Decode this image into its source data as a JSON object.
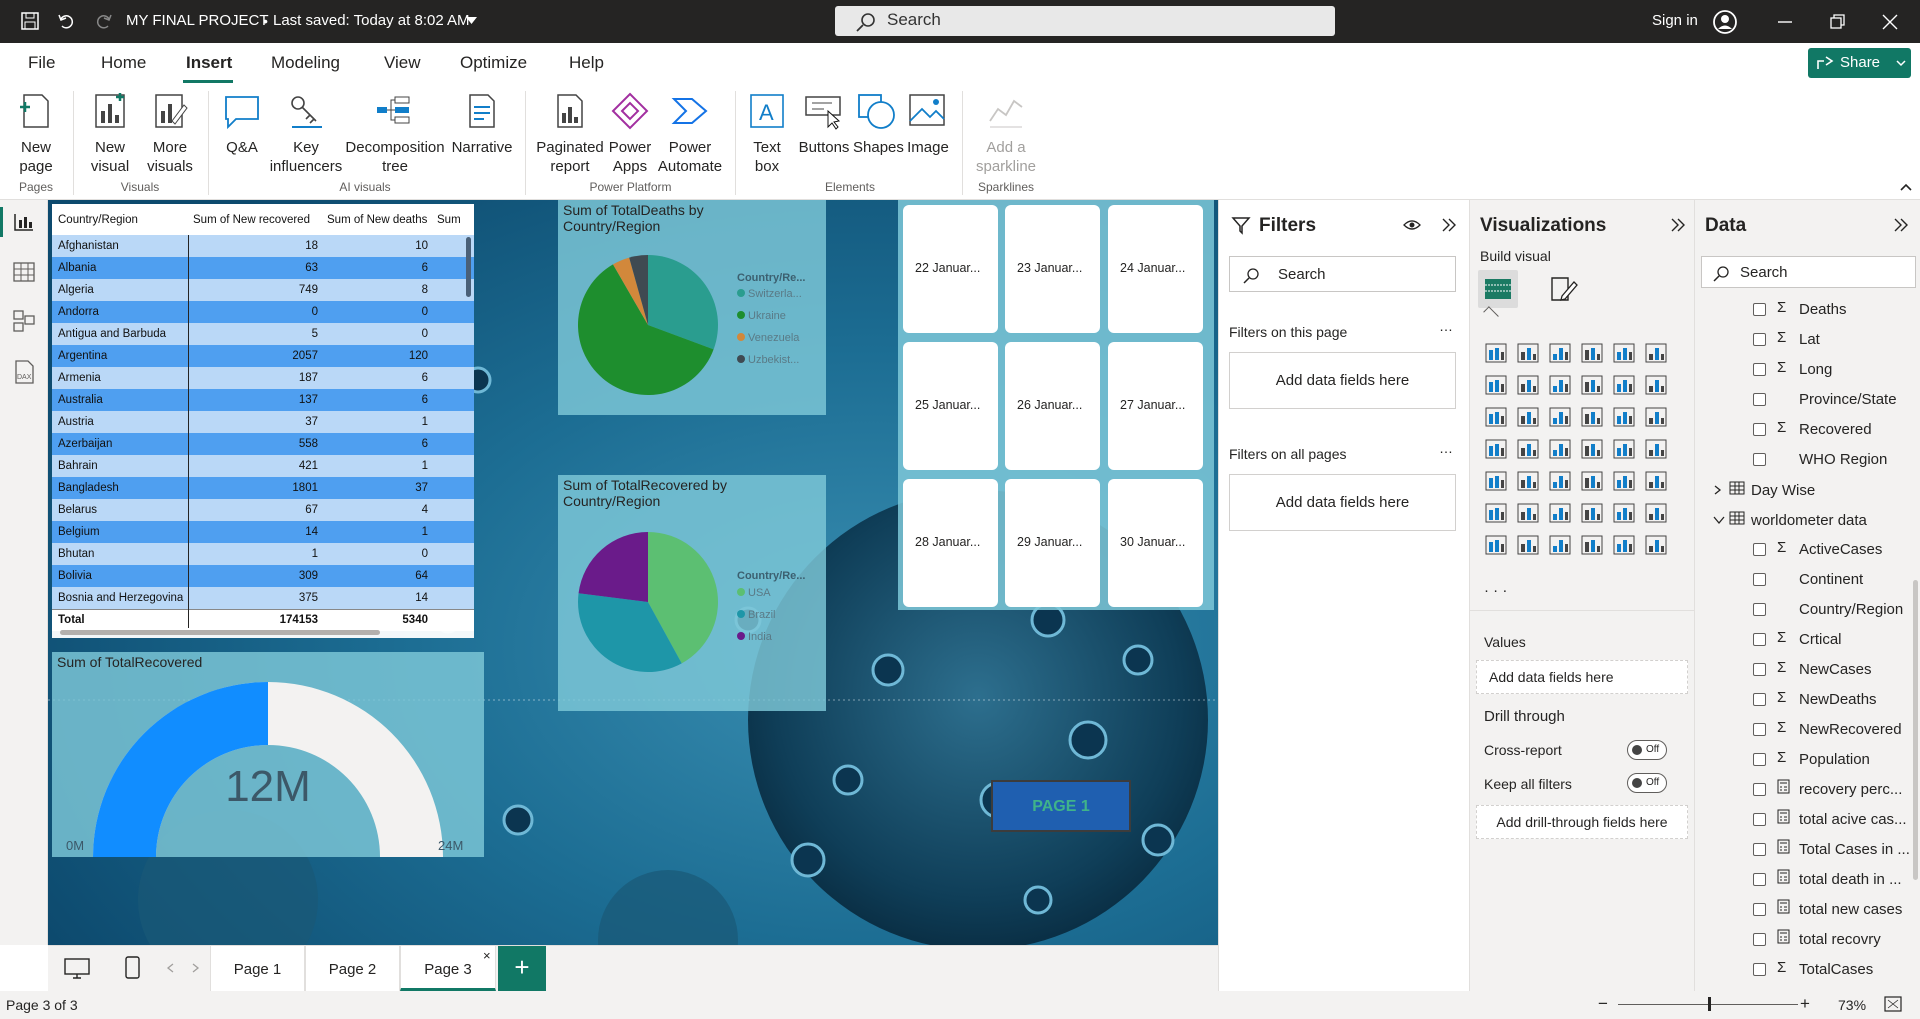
{
  "titlebar": {
    "title": "MY FINAL PROJECT",
    "saved": "Last saved: Today at 8:02 AM",
    "search_placeholder": "Search",
    "sign_in": "Sign in"
  },
  "ribbon_tabs": [
    "File",
    "Home",
    "Insert",
    "Modeling",
    "View",
    "Optimize",
    "Help"
  ],
  "share_label": "Share",
  "ribbon": {
    "new_page": "New page",
    "new_visual": "New visual",
    "more_visuals": "More visuals",
    "qa": "Q&A",
    "key_influencers": "Key influencers",
    "decomposition_tree": "Decomposition tree",
    "narrative": "Narrative",
    "paginated_report": "Paginated report",
    "power_apps": "Power Apps",
    "power_automate": "Power Automate",
    "text_box": "Text box",
    "buttons": "Buttons",
    "shapes": "Shapes",
    "image": "Image",
    "add_sparkline": "Add a sparkline",
    "groups": {
      "pages": "Pages",
      "visuals": "Visuals",
      "ai": "AI visuals",
      "power_platform": "Power Platform",
      "elements": "Elements",
      "sparklines": "Sparklines"
    }
  },
  "matrix": {
    "headers": [
      "Country/Region",
      "Sum of New recovered",
      "Sum of New deaths",
      "Sum"
    ],
    "rows": [
      [
        "Afghanistan",
        "18",
        "10"
      ],
      [
        "Albania",
        "63",
        "6"
      ],
      [
        "Algeria",
        "749",
        "8"
      ],
      [
        "Andorra",
        "0",
        "0"
      ],
      [
        "Antigua and Barbuda",
        "5",
        "0"
      ],
      [
        "Argentina",
        "2057",
        "120"
      ],
      [
        "Armenia",
        "187",
        "6"
      ],
      [
        "Australia",
        "137",
        "6"
      ],
      [
        "Austria",
        "37",
        "1"
      ],
      [
        "Azerbaijan",
        "558",
        "6"
      ],
      [
        "Bahrain",
        "421",
        "1"
      ],
      [
        "Bangladesh",
        "1801",
        "37"
      ],
      [
        "Belarus",
        "67",
        "4"
      ],
      [
        "Belgium",
        "14",
        "1"
      ],
      [
        "Bhutan",
        "1",
        "0"
      ],
      [
        "Bolivia",
        "309",
        "64"
      ],
      [
        "Bosnia and Herzegovina",
        "375",
        "14"
      ]
    ],
    "total": [
      "Total",
      "174153",
      "5340"
    ]
  },
  "pie1": {
    "title": "Sum of TotalDeaths by Country/Region",
    "legend_title": "Country/Re...",
    "legend": [
      {
        "label": "Switzerla...",
        "color": "#2a9d8f"
      },
      {
        "label": "Ukraine",
        "color": "#1e8e2e"
      },
      {
        "label": "Venezuela",
        "color": "#d2883b"
      },
      {
        "label": "Uzbekist...",
        "color": "#3f4a52"
      }
    ]
  },
  "pie2": {
    "title": "Sum of TotalRecovered by Country/Region",
    "legend_title": "Country/Re...",
    "legend": [
      {
        "label": "USA",
        "color": "#5cbf72"
      },
      {
        "label": "Brazil",
        "color": "#1e96a8"
      },
      {
        "label": "India",
        "color": "#6a1b8a"
      }
    ]
  },
  "gauge": {
    "title": "Sum of TotalRecovered",
    "value_label": "12M",
    "min": "0M",
    "max": "24M",
    "value": 12,
    "max_value": 24
  },
  "cards": [
    "22 Januar...",
    "23 Januar...",
    "24 Januar...",
    "25 Januar...",
    "26 Januar...",
    "27 Januar...",
    "28 Januar...",
    "29 Januar...",
    "30 Januar..."
  ],
  "page_button": "PAGE 1",
  "pages": [
    "Page 1",
    "Page 2",
    "Page 3"
  ],
  "status": {
    "page_of": "Page 3 of 3",
    "zoom": "73%"
  },
  "filters": {
    "title": "Filters",
    "search": "Search",
    "on_page": "Filters on this page",
    "add_fields": "Add data fields here",
    "on_all": "Filters on all pages",
    "add_fields2": "Add data fields here"
  },
  "viz": {
    "title": "Visualizations",
    "build": "Build visual",
    "values": "Values",
    "values_add": "Add data fields here",
    "drill": "Drill through",
    "cross": "Cross-report",
    "keep": "Keep all filters",
    "toggle_off": "Off",
    "drill_add": "Add drill-through fields here"
  },
  "data": {
    "title": "Data",
    "search": "Search",
    "fields": [
      {
        "label": "Deaths",
        "sigma": true
      },
      {
        "label": "Lat",
        "sigma": true
      },
      {
        "label": "Long",
        "sigma": true
      },
      {
        "label": "Province/State",
        "sigma": false
      },
      {
        "label": "Recovered",
        "sigma": true
      },
      {
        "label": "WHO Region",
        "sigma": false
      }
    ],
    "tables": [
      "Day Wise",
      "worldometer data"
    ],
    "fields2": [
      {
        "label": "ActiveCases",
        "kind": "sigma"
      },
      {
        "label": "Continent",
        "kind": ""
      },
      {
        "label": "Country/Region",
        "kind": ""
      },
      {
        "label": "Crtical",
        "kind": "sigma"
      },
      {
        "label": "NewCases",
        "kind": "sigma"
      },
      {
        "label": "NewDeaths",
        "kind": "sigma"
      },
      {
        "label": "NewRecovered",
        "kind": "sigma"
      },
      {
        "label": "Population",
        "kind": "sigma"
      },
      {
        "label": "recovery perc...",
        "kind": "calc"
      },
      {
        "label": "total acive cas...",
        "kind": "calc"
      },
      {
        "label": "Total Cases in ...",
        "kind": "calc"
      },
      {
        "label": "total death in ...",
        "kind": "calc"
      },
      {
        "label": "total new cases",
        "kind": "calc"
      },
      {
        "label": "total recovry",
        "kind": "calc"
      },
      {
        "label": "TotalCases",
        "kind": "sigma"
      }
    ]
  }
}
